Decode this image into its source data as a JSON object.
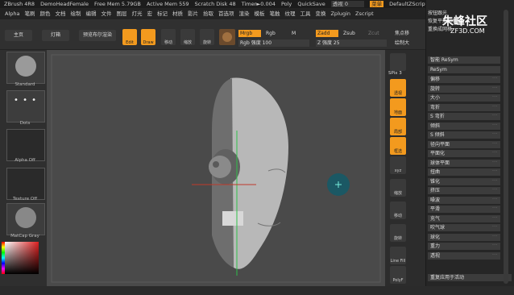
{
  "title_bar": {
    "app": "ZBrush 4R8",
    "doc": "DemoHeadFemale",
    "free_mem": "Free Mem 5.79GB",
    "active_mem": "Active Mem 559",
    "scratch": "Scratch Disk 48",
    "timer": "Timer►0.004",
    "poly": "Poly",
    "quicksave": "QuickSave",
    "transparency": "透视 0",
    "menu_btn": "菜单",
    "script": "DefaultZScript"
  },
  "menubar": [
    "Alpha",
    "笔刷",
    "颜色",
    "文档",
    "绘制",
    "编辑",
    "文件",
    "图层",
    "灯光",
    "宏",
    "标记",
    "材质",
    "影片",
    "拾取",
    "首选项",
    "渲染",
    "模板",
    "笔触",
    "纹理",
    "工具",
    "变换",
    "Zplugin",
    "Zscript"
  ],
  "toolbar": {
    "home": "主页",
    "lightbox": "灯箱",
    "preview": "预览布尔渲染",
    "edit": "Edit",
    "draw": "Draw",
    "move": "移动",
    "scale": "缩放",
    "rotate": "旋转",
    "mrgb": "Mrgb",
    "rgb": "Rgb",
    "m": "M",
    "zadd": "Zadd",
    "zsub": "Zsub",
    "zcut": "Zcut",
    "rgb_intensity": "Rgb 强度 100",
    "z_intensity": "Z 强度 25",
    "focal": "焦点移",
    "draw_size": "绘制大"
  },
  "left_panel": {
    "standard": "Standard",
    "dots": "Dots",
    "alpha_off": "Alpha Off",
    "texture_off": "Texture Off",
    "matcap": "MatCap Gray"
  },
  "shelf": {
    "spix": "SPix 3",
    "persp": "透视",
    "floor": "地面",
    "local": "局部",
    "frame": "框选",
    "xyz": "xyz",
    "scale": "缩放",
    "move": "移动",
    "rotate": "旋转",
    "linefill": "Line Fill",
    "polyf": "PolyF"
  },
  "right_panel": {
    "header1": "按钮跟光",
    "header2": "恢复平滑网格",
    "header3": "重换成网格",
    "symmetry": "智能 ReSym",
    "resym": "ReSym",
    "rows": [
      "偏移",
      "旋转",
      "大小",
      "弯折",
      "S 弯折",
      "倾斜",
      "S 倾斜",
      "径向平面",
      "平面化",
      "球体平面",
      "扭曲",
      "锥化",
      "挤压",
      "噪波",
      "平滑",
      "充气",
      "吹气球",
      "球化",
      "重力",
      "透视"
    ],
    "footer": "重复应用于活动"
  },
  "watermark": {
    "site": "朱峰社区",
    "url": "ZF3D.COM"
  }
}
